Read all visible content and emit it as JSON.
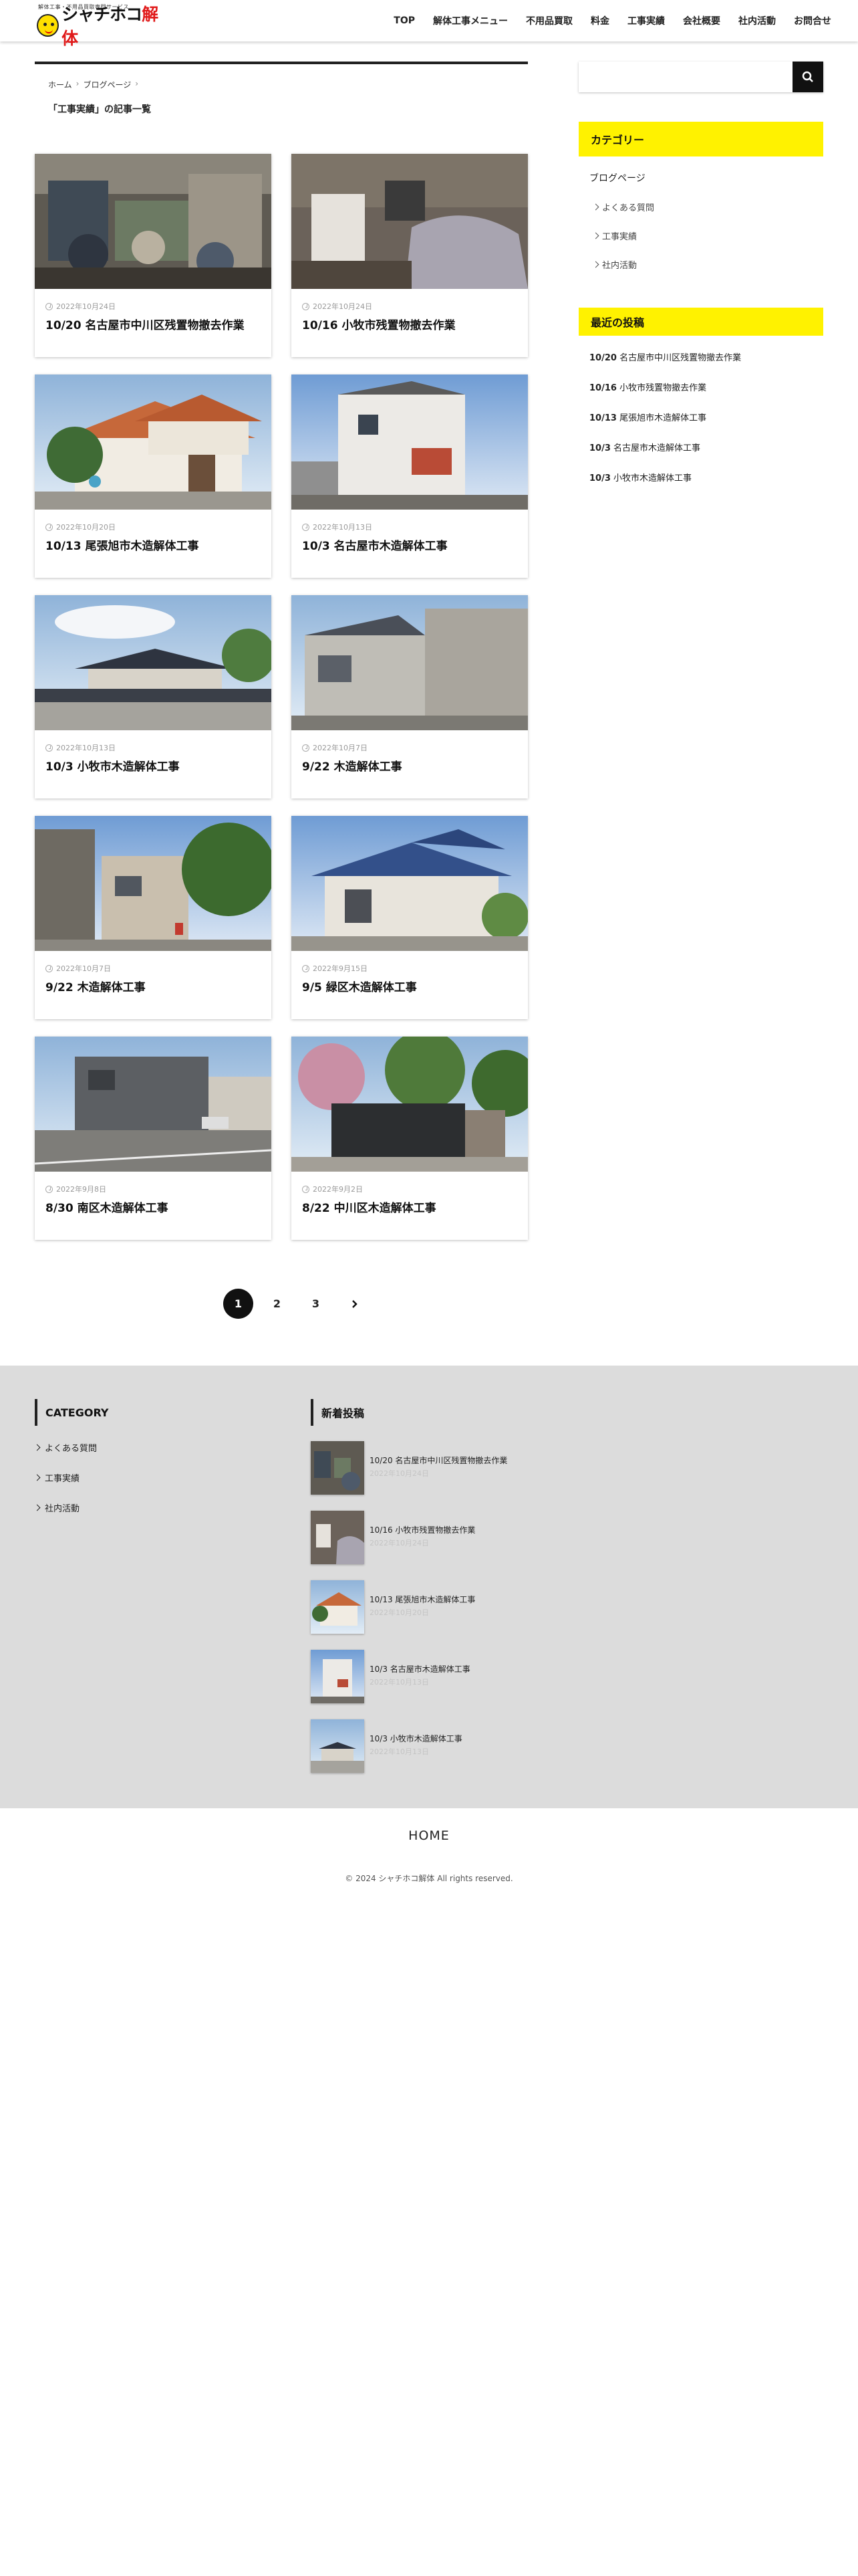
{
  "header": {
    "logo_tagline": "解体工事・不用品買取専門サービス",
    "logo_text_black": "シャチホコ",
    "logo_text_red": "解体",
    "nav": [
      "TOP",
      "解体工事メニュー",
      "不用品買取",
      "料金",
      "工事実績",
      "会社概要",
      "社内活動",
      "お問合せ"
    ]
  },
  "breadcrumb": {
    "items": [
      "ホーム",
      "ブログページ"
    ],
    "separator": "›"
  },
  "archive_title": "「工事実績」の記事一覧",
  "posts": [
    {
      "date": "2022年10月24日",
      "title": "10/20 名古屋市中川区残置物撤去作業",
      "image": "junk-room-1"
    },
    {
      "date": "2022年10月24日",
      "title": "10/16 小牧市残置物撤去作業",
      "image": "junk-room-2"
    },
    {
      "date": "2022年10月20日",
      "title": "10/13 尾張旭市木造解体工事",
      "image": "house-orange-roof"
    },
    {
      "date": "2022年10月13日",
      "title": "10/3 名古屋市木造解体工事",
      "image": "house-white-siding"
    },
    {
      "date": "2022年10月13日",
      "title": "10/3 小牧市木造解体工事",
      "image": "house-dark-roof-sky"
    },
    {
      "date": "2022年10月7日",
      "title": "9/22 木造解体工事",
      "image": "house-grey-alley"
    },
    {
      "date": "2022年10月7日",
      "title": "9/22 木造解体工事",
      "image": "house-narrow-street"
    },
    {
      "date": "2022年9月15日",
      "title": "9/5 緑区木造解体工事",
      "image": "house-blue-roof"
    },
    {
      "date": "2022年9月8日",
      "title": "8/30 南区木造解体工事",
      "image": "building-street-corner"
    },
    {
      "date": "2022年9月2日",
      "title": "8/22 中川区木造解体工事",
      "image": "gate-trees"
    }
  ],
  "pagination": {
    "pages": [
      "1",
      "2",
      "3"
    ],
    "current": "1",
    "next": "›"
  },
  "sidebar": {
    "search_placeholder": "",
    "category_title": "カテゴリー",
    "category_main": "ブログページ",
    "categories": [
      "よくある質問",
      "工事実績",
      "社内活動"
    ],
    "recent_title": "最近の投稿",
    "recent": [
      {
        "num": "10/20",
        "rest": "名古屋市中川区残置物撤去作業"
      },
      {
        "num": "10/16",
        "rest": "小牧市残置物撤去作業"
      },
      {
        "num": "10/13",
        "rest": "尾張旭市木造解体工事"
      },
      {
        "num": "10/3",
        "rest": "名古屋市木造解体工事"
      },
      {
        "num": "10/3",
        "rest": "小牧市木造解体工事"
      }
    ]
  },
  "footer_widgets": {
    "category_title": "CATEGORY",
    "categories": [
      "よくある質問",
      "工事実績",
      "社内活動"
    ],
    "recent_title": "新着投稿",
    "recent": [
      {
        "title": "10/20 名古屋市中川区残置物撤去作業",
        "date": "2022年10月24日",
        "image": "junk-room-1"
      },
      {
        "title": "10/16 小牧市残置物撤去作業",
        "date": "2022年10月24日",
        "image": "junk-room-2"
      },
      {
        "title": "10/13 尾張旭市木造解体工事",
        "date": "2022年10月20日",
        "image": "house-orange-roof"
      },
      {
        "title": "10/3 名古屋市木造解体工事",
        "date": "2022年10月13日",
        "image": "house-white-siding"
      },
      {
        "title": "10/3 小牧市木造解体工事",
        "date": "2022年10月13日",
        "image": "house-dark-roof-sky"
      }
    ]
  },
  "footer": {
    "home": "HOME",
    "copyright": "© 2024 シャチホコ解体 All rights reserved."
  },
  "colors": {
    "accent_yellow": "#fff200",
    "logo_red": "#e01a1a",
    "dark": "#111111",
    "footer_bg": "#dcdcdc"
  }
}
